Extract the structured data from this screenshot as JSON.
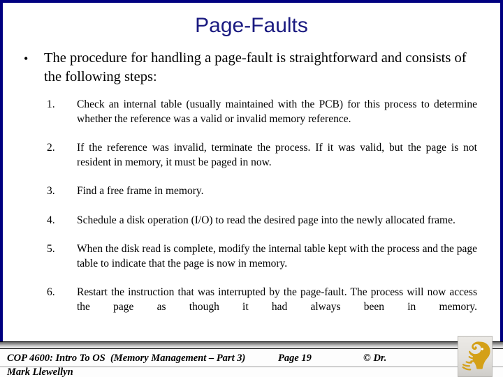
{
  "slide": {
    "title": "Page-Faults",
    "title_color": "#1a1a80",
    "frame_color": "#000080",
    "background_color": "#ffffff"
  },
  "intro": {
    "bullet_glyph": "•",
    "text": "The procedure for handling a page-fault is straightforward and consists of the following steps:"
  },
  "steps": [
    {
      "number": "1.",
      "text": "Check an internal table (usually maintained with the PCB) for this process to determine whether the reference was a valid or invalid memory reference."
    },
    {
      "number": "2.",
      "text": "If the reference was invalid, terminate the process.  If it was valid, but the page is not resident in memory, it must be paged in now."
    },
    {
      "number": "3.",
      "text": "Find a free frame in memory."
    },
    {
      "number": "4.",
      "text": "Schedule a disk operation (I/O) to read the desired page into the newly allocated frame."
    },
    {
      "number": "5.",
      "text": "When the disk read is complete, modify the internal table kept with the process and the page table to indicate that the page is now in memory."
    },
    {
      "number": "6.",
      "text": "Restart the instruction that was interrupted by the page-fault.  The process will now access the page as though it had always been in  memory."
    }
  ],
  "footer": {
    "course": "COP 4600: Intro To OS  (Memory Management – Part 3)",
    "page": "Page 19",
    "copyright": "© Dr.",
    "author": "Mark Llewellyn",
    "logo_name": "ucf-pegasus-logo",
    "logo_color": "#d4a017"
  }
}
